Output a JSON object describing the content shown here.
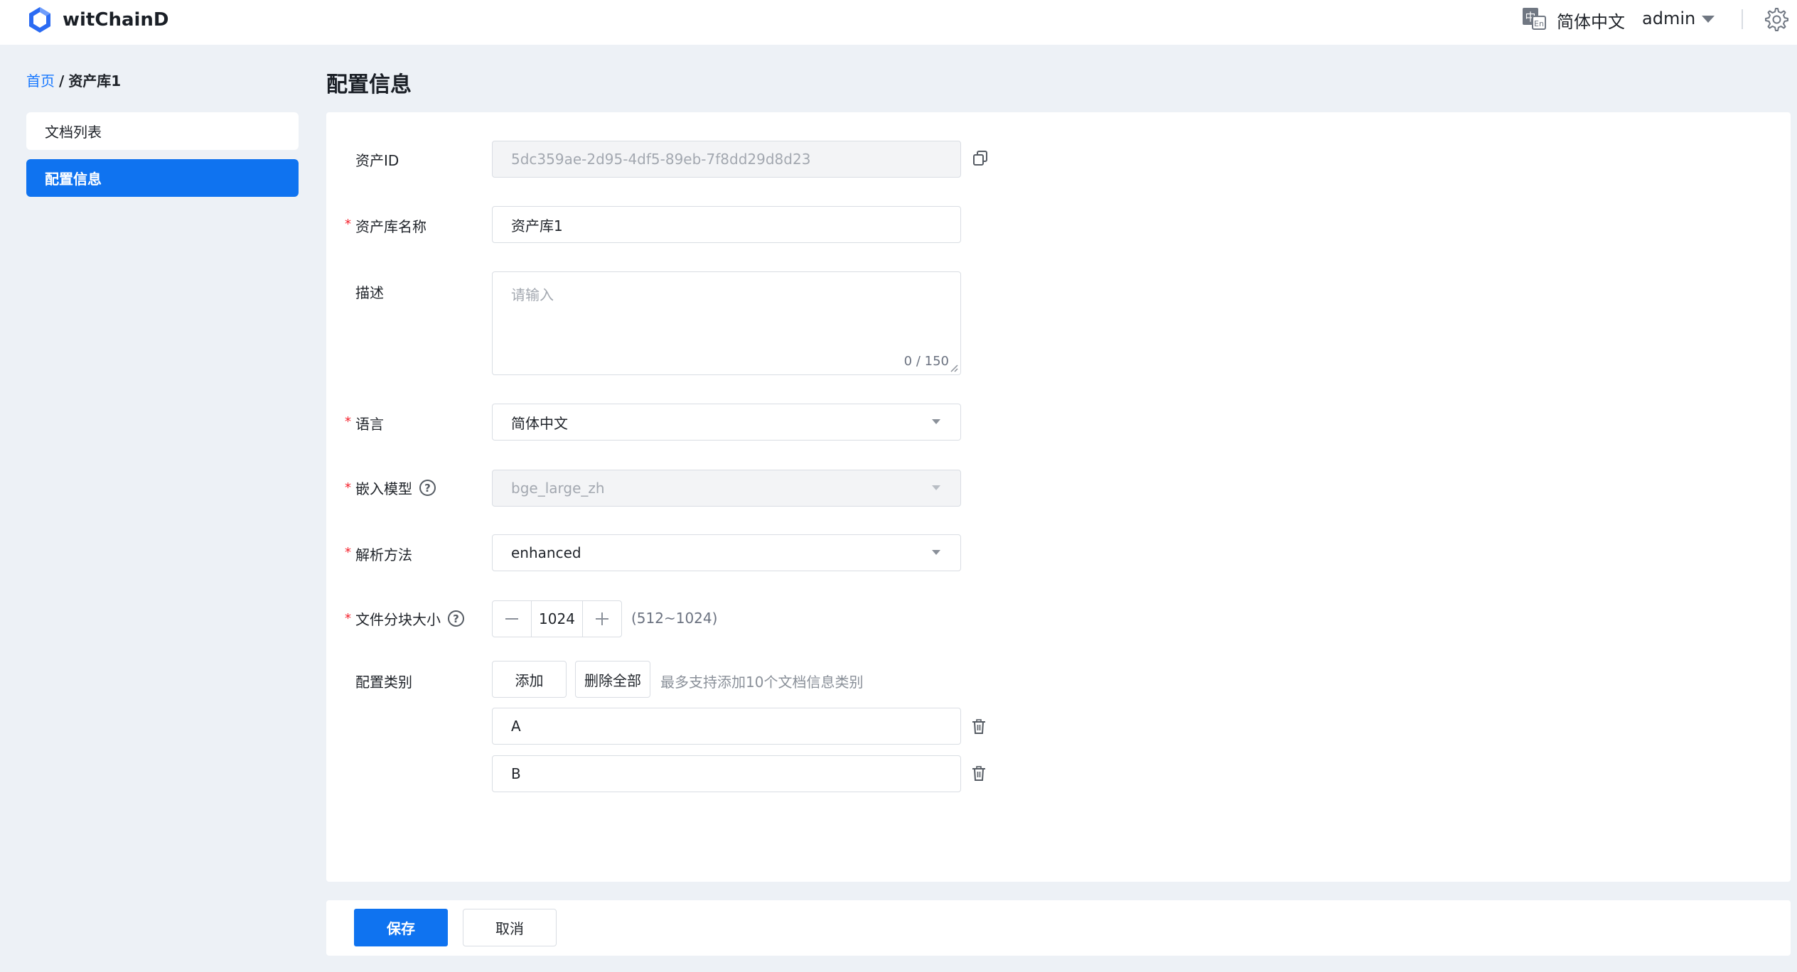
{
  "header": {
    "app_title": "witChainD",
    "language": "简体中文",
    "user": "admin"
  },
  "breadcrumb": {
    "home": "首页",
    "separator": "/",
    "current": "资产库1"
  },
  "sidebar": {
    "items": [
      {
        "label": "文档列表",
        "active": false
      },
      {
        "label": "配置信息",
        "active": true
      }
    ]
  },
  "page_title": "配置信息",
  "form": {
    "asset_id": {
      "label": "资产ID",
      "value": "5dc359ae-2d95-4df5-89eb-7f8dd29d8d23"
    },
    "name": {
      "label": "资产库名称",
      "value": "资产库1"
    },
    "description": {
      "label": "描述",
      "placeholder": "请输入",
      "count": "0 / 150"
    },
    "language": {
      "label": "语言",
      "value": "简体中文"
    },
    "embedding_model": {
      "label": "嵌入模型",
      "value": "bge_large_zh"
    },
    "parse_method": {
      "label": "解析方法",
      "value": "enhanced"
    },
    "chunk_size": {
      "label": "文件分块大小",
      "value": "1024",
      "hint": "(512~1024)"
    },
    "categories": {
      "label": "配置类别",
      "add_label": "添加",
      "delete_all_label": "删除全部",
      "hint": "最多支持添加10个文档信息类别",
      "items": [
        "A",
        "B"
      ]
    },
    "required_mark": "*",
    "help_mark": "?"
  },
  "footer": {
    "save_label": "保存",
    "cancel_label": "取消"
  },
  "colors": {
    "primary": "#0f73f0",
    "background": "#edf1f6",
    "required": "#f5222d",
    "logo": "#2b6bf3"
  },
  "icons": [
    "logo-icon",
    "language-icon",
    "caret-down-icon",
    "settings-gear-icon",
    "copy-icon",
    "help-icon",
    "minus-icon",
    "plus-icon",
    "trash-icon",
    "resize-grip-icon"
  ]
}
